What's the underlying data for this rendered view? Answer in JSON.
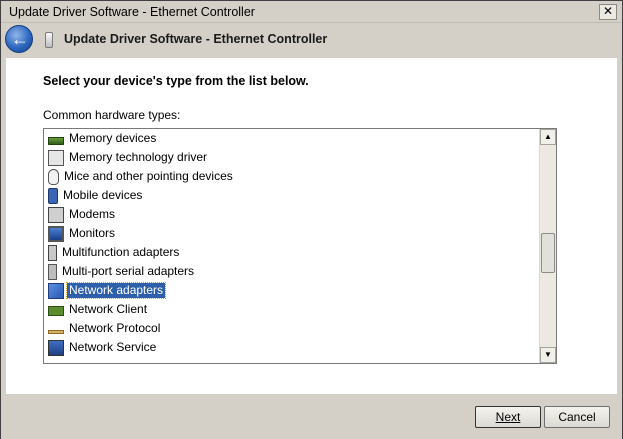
{
  "window": {
    "title": "Update Driver Software - Ethernet Controller",
    "close_glyph": "✕"
  },
  "header": {
    "back_glyph": "←",
    "title": "Update Driver Software - Ethernet Controller"
  },
  "main": {
    "prompt": "Select your device's type from the list below.",
    "list_label": "Common hardware types:",
    "items": [
      {
        "label": "Memory devices",
        "icon": "memory-icon"
      },
      {
        "label": "Memory technology driver",
        "icon": "memory-tech-icon"
      },
      {
        "label": "Mice and other pointing devices",
        "icon": "mouse-icon"
      },
      {
        "label": "Mobile devices",
        "icon": "mobile-icon"
      },
      {
        "label": "Modems",
        "icon": "modem-icon"
      },
      {
        "label": "Monitors",
        "icon": "monitor-icon"
      },
      {
        "label": "Multifunction adapters",
        "icon": "multifunction-icon"
      },
      {
        "label": "Multi-port serial adapters",
        "icon": "serial-icon"
      },
      {
        "label": "Network adapters",
        "icon": "network-adapter-icon",
        "selected": true
      },
      {
        "label": "Network Client",
        "icon": "network-client-icon"
      },
      {
        "label": "Network Protocol",
        "icon": "network-protocol-icon"
      },
      {
        "label": "Network Service",
        "icon": "network-service-icon"
      }
    ],
    "scroll_up_glyph": "▲",
    "scroll_down_glyph": "▼"
  },
  "footer": {
    "next_label": "Next",
    "cancel_label": "Cancel"
  },
  "colors": {
    "selection": "#2e5faa",
    "window_bg": "#d4d0c8",
    "content_bg": "#ffffff"
  }
}
